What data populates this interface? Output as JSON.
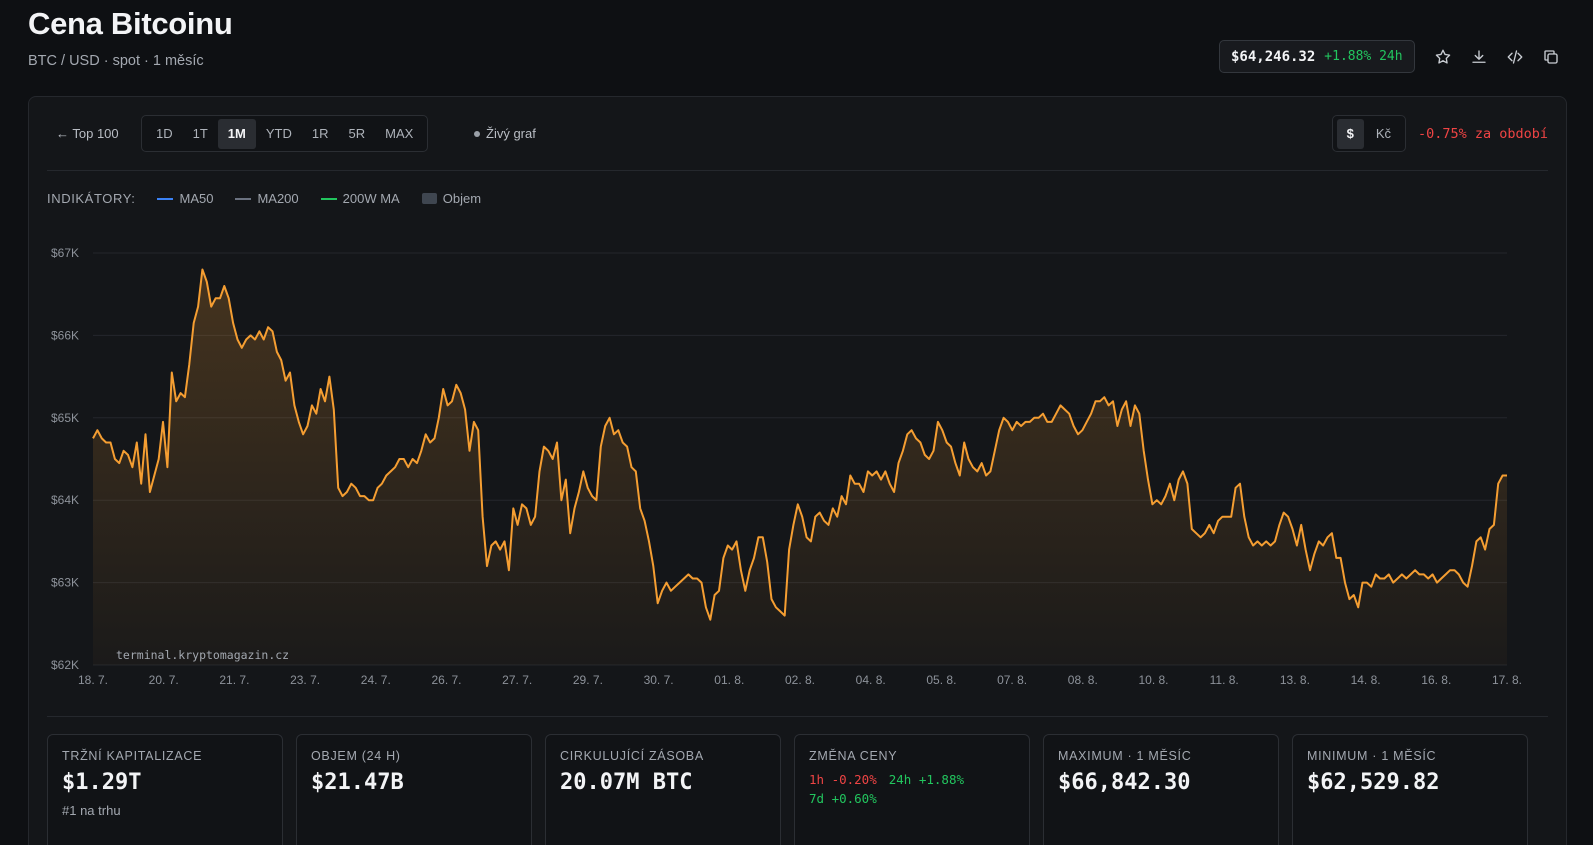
{
  "header": {
    "title": "Cena Bitcoinu",
    "subtitle": "BTC / USD · spot · 1 měsíc",
    "price": "$64,246.32",
    "change_24h": "+1.88% 24h",
    "icons": [
      "star-icon",
      "download-icon",
      "code-icon",
      "copy-icon"
    ]
  },
  "toolbar": {
    "back_label": "← Top 100",
    "ranges": [
      "1D",
      "1T",
      "1M",
      "YTD",
      "1R",
      "5R",
      "MAX"
    ],
    "active_range": "1M",
    "live_label": "Živý graf",
    "currencies": [
      "$",
      "Kč"
    ],
    "active_currency": "$",
    "period_change": "-0.75% za období"
  },
  "indicators": {
    "label": "INDIKÁTORY:",
    "items": [
      {
        "name": "MA50",
        "color": "#3b82f6",
        "kind": "line"
      },
      {
        "name": "MA200",
        "color": "#6b7280",
        "kind": "line"
      },
      {
        "name": "200W MA",
        "color": "#22c55e",
        "kind": "line"
      },
      {
        "name": "Objem",
        "color": "#3f4650",
        "kind": "box"
      }
    ]
  },
  "chart_data": {
    "type": "area",
    "line_color": "#f59e32",
    "y_ticks": [
      "$67K",
      "$66K",
      "$65K",
      "$64K",
      "$63K",
      "$62K"
    ],
    "ylim": [
      62000,
      67000
    ],
    "x_ticks": [
      "18. 7.",
      "20. 7.",
      "21. 7.",
      "23. 7.",
      "24. 7.",
      "26. 7.",
      "27. 7.",
      "29. 7.",
      "30. 7.",
      "01. 8.",
      "02. 8.",
      "04. 8.",
      "05. 8.",
      "07. 8.",
      "08. 8.",
      "10. 8.",
      "11. 8.",
      "13. 8.",
      "14. 8.",
      "16. 8.",
      "17. 8."
    ],
    "watermark": "terminal.kryptomagazin.cz",
    "series": [
      {
        "values": [
          64750,
          64850,
          64750,
          64700,
          64700,
          64500,
          64450,
          64600,
          64550,
          64400,
          64700,
          64200,
          64800,
          64100,
          64300,
          64500,
          64950,
          64400,
          65550,
          65200,
          65300,
          65250,
          65650,
          66150,
          66350,
          66800,
          66650,
          66350,
          66450,
          66450,
          66600,
          66450,
          66150,
          65950,
          65850,
          65950,
          66000,
          65950,
          66050,
          65950,
          66100,
          66050,
          65800,
          65700,
          65450,
          65550,
          65150,
          64950,
          64800,
          64900,
          65150,
          65050,
          65350,
          65200,
          65500,
          65100,
          64150,
          64050,
          64100,
          64200,
          64150,
          64050,
          64050,
          64000,
          64000,
          64150,
          64200,
          64300,
          64350,
          64400,
          64500,
          64500,
          64400,
          64500,
          64450,
          64600,
          64800,
          64700,
          64750,
          65000,
          65350,
          65150,
          65200,
          65400,
          65300,
          65100,
          64600,
          64950,
          64850,
          63800,
          63200,
          63450,
          63500,
          63400,
          63500,
          63150,
          63900,
          63700,
          63950,
          63900,
          63700,
          63800,
          64350,
          64650,
          64600,
          64500,
          64700,
          64000,
          64250,
          63600,
          63900,
          64100,
          64350,
          64150,
          64050,
          64000,
          64650,
          64900,
          65000,
          64800,
          64850,
          64700,
          64650,
          64400,
          64350,
          63900,
          63750,
          63500,
          63200,
          62750,
          62900,
          63000,
          62900,
          62950,
          63000,
          63050,
          63100,
          63050,
          63050,
          63000,
          62700,
          62550,
          62850,
          62900,
          63300,
          63450,
          63400,
          63500,
          63150,
          62900,
          63150,
          63300,
          63550,
          63550,
          63250,
          62800,
          62700,
          62650,
          62600,
          63400,
          63700,
          63950,
          63800,
          63550,
          63500,
          63800,
          63850,
          63750,
          63700,
          63900,
          63800,
          64050,
          63950,
          64300,
          64200,
          64200,
          64100,
          64350,
          64300,
          64350,
          64250,
          64350,
          64200,
          64100,
          64450,
          64600,
          64800,
          64850,
          64750,
          64700,
          64550,
          64500,
          64600,
          64950,
          64850,
          64700,
          64650,
          64450,
          64300,
          64700,
          64500,
          64400,
          64350,
          64450,
          64300,
          64350,
          64600,
          64850,
          65000,
          64950,
          64850,
          64950,
          64900,
          64950,
          64950,
          65000,
          65000,
          65050,
          64950,
          64950,
          65050,
          65150,
          65100,
          65050,
          64900,
          64800,
          64850,
          64950,
          65050,
          65200,
          65200,
          65250,
          65150,
          65200,
          64900,
          65100,
          65200,
          64900,
          65150,
          65050,
          64600,
          64250,
          63950,
          64000,
          63950,
          64050,
          64200,
          64000,
          64250,
          64350,
          64200,
          63650,
          63600,
          63550,
          63600,
          63700,
          63600,
          63750,
          63800,
          63800,
          63800,
          64150,
          64200,
          63800,
          63550,
          63450,
          63500,
          63450,
          63500,
          63450,
          63500,
          63700,
          63850,
          63800,
          63650,
          63450,
          63700,
          63400,
          63150,
          63350,
          63500,
          63450,
          63550,
          63600,
          63300,
          63300,
          63000,
          62800,
          62850,
          62700,
          63000,
          63000,
          62950,
          63100,
          63050,
          63050,
          63100,
          63000,
          63050,
          63100,
          63050,
          63100,
          63150,
          63100,
          63100,
          63050,
          63100,
          63000,
          63050,
          63100,
          63150,
          63150,
          63100,
          63000,
          62950,
          63200,
          63500,
          63550,
          63400,
          63650,
          63700,
          64200,
          64300,
          64300
        ]
      }
    ]
  },
  "stats": [
    {
      "label": "TRŽNÍ KAPITALIZACE",
      "value": "$1.29T",
      "sub": "#1 na trhu"
    },
    {
      "label": "OBJEM (24 H)",
      "value": "$21.47B"
    },
    {
      "label": "CIRKULUJÍCÍ ZÁSOBA",
      "value": "20.07M BTC"
    },
    {
      "label": "ZMĚNA CENY",
      "changes": {
        "h1": "1h -0.20%",
        "h24": "24h +1.88%",
        "d7": "7d +0.60%"
      }
    },
    {
      "label": "MAXIMUM · 1 MĚSÍC",
      "value": "$66,842.30"
    },
    {
      "label": "MINIMUM · 1 MĚSÍC",
      "value": "$62,529.82"
    }
  ]
}
